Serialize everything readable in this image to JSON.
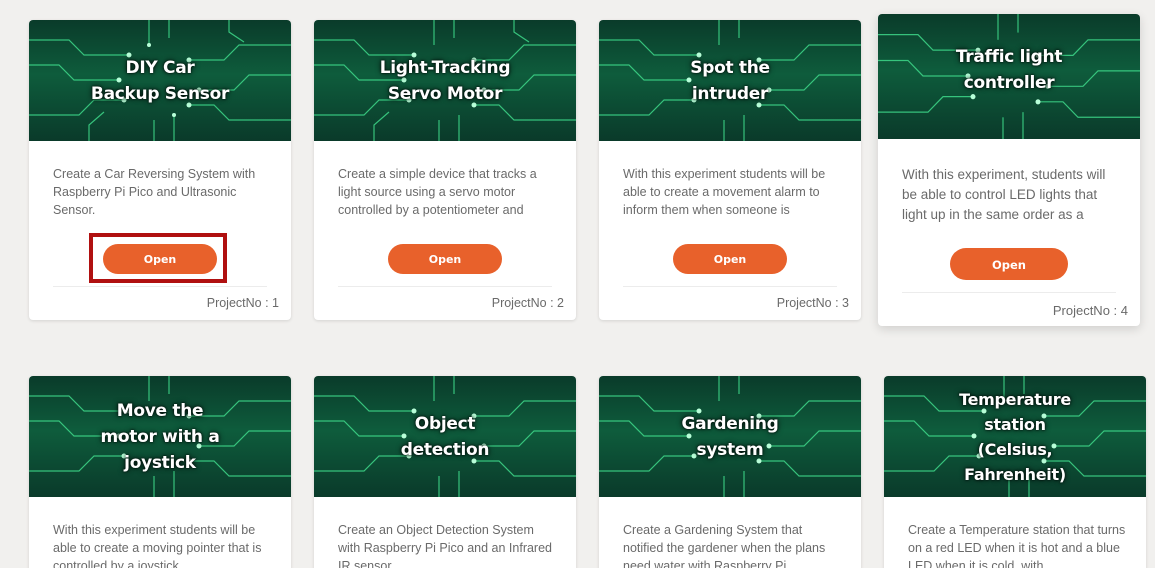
{
  "colors": {
    "accent": "#e8612b",
    "highlight": "#b01010",
    "banner_green": "#0e5c3c"
  },
  "open_label": "Open",
  "projects": [
    {
      "title": "DIY Car\nBackup Sensor",
      "description": "Create a Car Reversing System with Raspberry Pi Pico and Ultrasonic Sensor.",
      "project_no": "ProjectNo : 1"
    },
    {
      "title": "Light-Tracking\nServo Motor",
      "description": "Create a simple device that tracks a light source using a servo motor controlled by a potentiometer and",
      "project_no": "ProjectNo : 2"
    },
    {
      "title": "Spot the\nintruder",
      "description": "With this experiment students will be able to create a movement alarm to inform them when someone is",
      "project_no": "ProjectNo : 3"
    },
    {
      "title": "Traffic light\ncontroller",
      "description": "With this experiment, students will be able to control LED lights that light up in the same order as a",
      "project_no": "ProjectNo : 4"
    },
    {
      "title": "Move the\nmotor with a\njoystick",
      "description": "With this experiment students will be able to create a moving pointer that is controlled by a joystick"
    },
    {
      "title": "Object\ndetection",
      "description": "Create an Object Detection System with Raspberry Pi Pico and an Infrared IR sensor"
    },
    {
      "title": "Gardening\nsystem",
      "description": "Create a Gardening System that notified the gardener when the plans need water with Raspberry Pi"
    },
    {
      "title": "Temperature\nstation\n(Celsius,\nFahrenheit)",
      "description": "Create a Temperature station that turns on a red LED when it is hot and a blue LED when it is cold, with"
    }
  ]
}
